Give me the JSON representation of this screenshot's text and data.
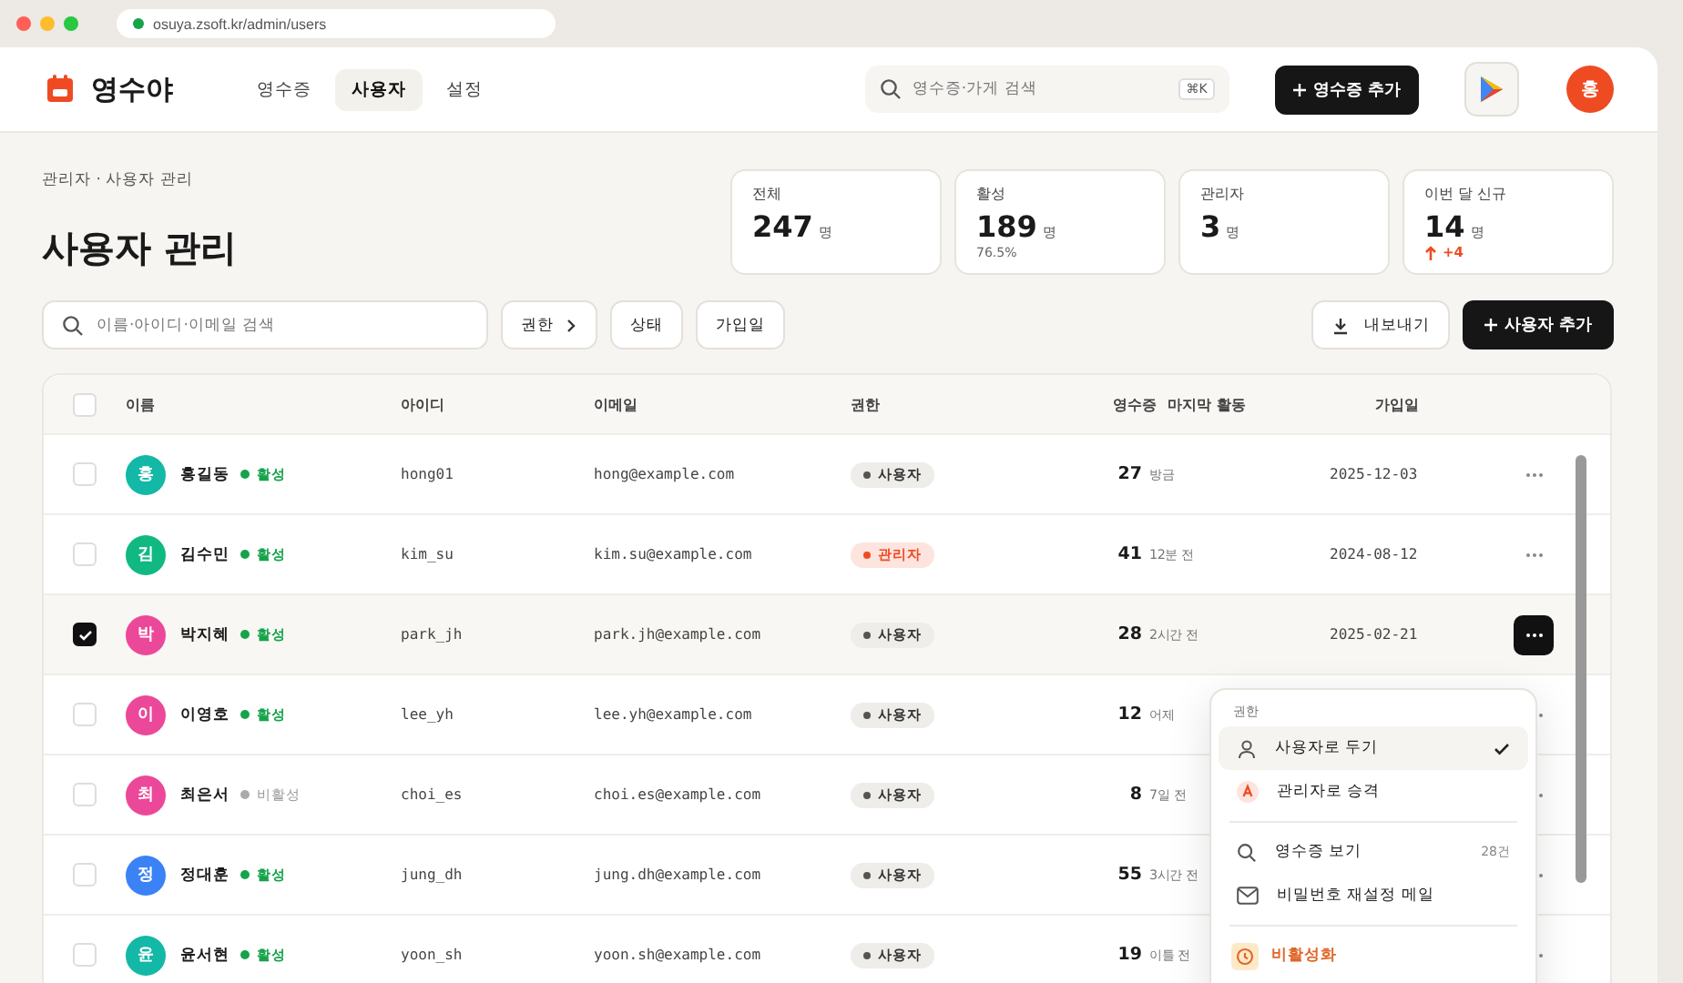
{
  "browser": {
    "url": "osuya.zsoft.kr/admin/users"
  },
  "header": {
    "logo": "영수야",
    "nav": [
      {
        "label": "영수증",
        "selected": false
      },
      {
        "label": "사용자",
        "selected": true
      },
      {
        "label": "설정",
        "selected": false
      }
    ],
    "search": {
      "placeholder": "영수증·가게 검색",
      "shortcut": "⌘K"
    },
    "add_button": "영수증 추가",
    "avatar": "홍"
  },
  "breadcrumb": "관리자 · 사용자 관리",
  "title": "사용자 관리",
  "stats": [
    {
      "label": "전체",
      "value": "247",
      "unit": "명"
    },
    {
      "label": "활성",
      "value": "189",
      "unit": "명",
      "sub": "76.5%"
    },
    {
      "label": "관리자",
      "value": "3",
      "unit": "명"
    },
    {
      "label": "이번 달 신규",
      "value": "14",
      "unit": "명",
      "delta": "+4"
    }
  ],
  "filters": {
    "placeholder": "이름·아이디·이메일 검색",
    "chips": [
      "권한",
      "상태",
      "가입일"
    ],
    "export": "내보내기",
    "add_user": "사용자 추가"
  },
  "table": {
    "all_checked": false,
    "columns": [
      "이름",
      "아이디",
      "이메일",
      "권한",
      "영수증",
      "마지막 활동",
      "가입일"
    ],
    "rows": [
      {
        "checked": false,
        "initial": "홍",
        "color": "#14b8a6",
        "name": "홍길동",
        "active": true,
        "status": "활성",
        "id": "hong01",
        "email": "hong@example.com",
        "role": "사용자",
        "admin": false,
        "receipts": "27",
        "last": "방금",
        "joined": "2025-12-03"
      },
      {
        "checked": false,
        "initial": "김",
        "color": "#10b981",
        "name": "김수민",
        "active": true,
        "status": "활성",
        "id": "kim_su",
        "email": "kim.su@example.com",
        "role": "관리자",
        "admin": true,
        "receipts": "41",
        "last": "12분 전",
        "joined": "2024-08-12"
      },
      {
        "checked": true,
        "initial": "박",
        "color": "#ec4899",
        "name": "박지혜",
        "active": true,
        "status": "활성",
        "id": "park_jh",
        "email": "park.jh@example.com",
        "role": "사용자",
        "admin": false,
        "receipts": "28",
        "last": "2시간 전",
        "joined": "2025-02-21"
      },
      {
        "checked": false,
        "initial": "이",
        "color": "#ec4899",
        "name": "이영호",
        "active": true,
        "status": "활성",
        "id": "lee_yh",
        "email": "lee.yh@example.com",
        "role": "사용자",
        "admin": false,
        "receipts": "12",
        "last": "어제",
        "joined": ""
      },
      {
        "checked": false,
        "initial": "최",
        "color": "#ec4899",
        "name": "최은서",
        "active": false,
        "status": "비활성",
        "id": "choi_es",
        "email": "choi.es@example.com",
        "role": "사용자",
        "admin": false,
        "receipts": "8",
        "last": "7일 전",
        "joined": ""
      },
      {
        "checked": false,
        "initial": "정",
        "color": "#3b82f6",
        "name": "정대훈",
        "active": true,
        "status": "활성",
        "id": "jung_dh",
        "email": "jung.dh@example.com",
        "role": "사용자",
        "admin": false,
        "receipts": "55",
        "last": "3시간 전",
        "joined": ""
      },
      {
        "checked": false,
        "initial": "윤",
        "color": "#14b8a6",
        "name": "윤서현",
        "active": true,
        "status": "활성",
        "id": "yoon_sh",
        "email": "yoon.sh@example.com",
        "role": "사용자",
        "admin": false,
        "receipts": "19",
        "last": "이틀 전",
        "joined": ""
      }
    ]
  },
  "menu": {
    "section": "권한",
    "items": [
      {
        "kind": "user",
        "label": "사용자로 두기",
        "selected": true
      },
      {
        "kind": "admin",
        "label": "관리자로 승격",
        "selected": false
      },
      {
        "kind": "divider"
      },
      {
        "kind": "search",
        "label": "영수증 보기",
        "meta": "28건"
      },
      {
        "kind": "mail",
        "label": "비밀번호 재설정 메일"
      },
      {
        "kind": "divider"
      },
      {
        "kind": "danger",
        "label": "비활성화"
      }
    ]
  }
}
